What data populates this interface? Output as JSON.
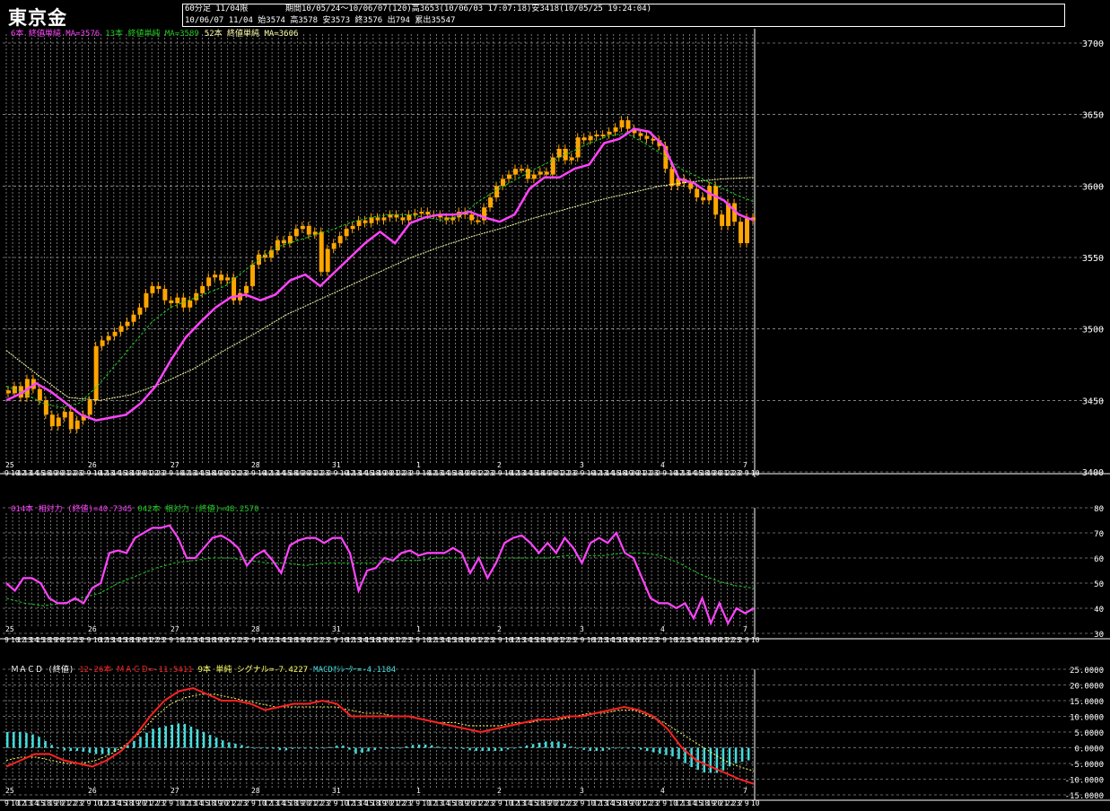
{
  "header": {
    "instrument": "東京金",
    "timeframe": "60分足 11/04限",
    "period": "期間10/05/24～10/06/07(120)高3653(10/06/03 17:07:18)安3418(10/05/25 19:24:04)",
    "last": "10/06/07 11/04 始3574 高3578 安3573 終3576 出794 累出35547"
  },
  "legends": {
    "price": [
      {
        "text": "6本 終値単純 MA=3576",
        "color": "#ff44ff"
      },
      {
        "text": "13本 終値単純 MA=3589",
        "color": "#22cc22"
      },
      {
        "text": "52本 終値単純 MA=3606",
        "color": "#ffffaa"
      }
    ],
    "rsi": [
      {
        "text": "014本 相対力 (終値)=40.7345",
        "color": "#ff44ff"
      },
      {
        "text": "042本 相対力 (終値)=48.2570",
        "color": "#22cc22"
      }
    ],
    "macd": [
      {
        "text": "ＭＡＣＤ (終値)",
        "color": "#ffffff"
      },
      {
        "text": "12-26本 ＭＡＣＤ=-11.5411",
        "color": "#ff2222"
      },
      {
        "text": "9本 単純 シグナル=-7.4227",
        "color": "#ffff66"
      },
      {
        "text": "MACDｵｼﾚｰﾀｰ=-4.1184",
        "color": "#44dddd"
      }
    ]
  },
  "colors": {
    "candle": "#ffa500",
    "ma6": "#ff44ff",
    "ma13": "#22cc22",
    "ma52": "#ffffaa",
    "rsi14": "#ff44ff",
    "rsi42": "#22cc22",
    "macd": "#ff2222",
    "signal": "#ffff66",
    "hist": "#44dddd"
  },
  "axes": {
    "price_ticks": [
      "3700",
      "3650",
      "3600",
      "3550",
      "3500",
      "3450",
      "3400"
    ],
    "rsi_ticks": [
      "80",
      "70",
      "60",
      "50",
      "40",
      "30"
    ],
    "macd_ticks": [
      "25.0000",
      "20.0000",
      "15.0000",
      "10.0000",
      "5.0000",
      "0.0000",
      "-5.0000",
      "-10.0000",
      "-15.0000"
    ],
    "day_labels": [
      "25",
      "26",
      "27",
      "28",
      "31",
      "1",
      "2",
      "3",
      "4",
      "7"
    ],
    "hour_pattern": [
      "9",
      "10",
      "12",
      "13",
      "14",
      "15",
      "18",
      "19",
      "20",
      "21",
      "22",
      "23",
      "2"
    ]
  },
  "chart_data": [
    {
      "type": "candlestick",
      "title": "東京金 60分足 11/04限",
      "ylim": [
        3400,
        3700
      ],
      "x_days": [
        "25",
        "26",
        "27",
        "28",
        "31",
        "1",
        "2",
        "3",
        "4",
        "7"
      ],
      "close_approx": [
        3455,
        3460,
        3452,
        3465,
        3458,
        3450,
        3440,
        3432,
        3438,
        3442,
        3430,
        3436,
        3440,
        3450,
        3488,
        3492,
        3495,
        3498,
        3502,
        3505,
        3510,
        3515,
        3525,
        3530,
        3528,
        3520,
        3518,
        3522,
        3515,
        3520,
        3525,
        3530,
        3536,
        3538,
        3534,
        3536,
        3520,
        3525,
        3530,
        3545,
        3552,
        3550,
        3555,
        3562,
        3560,
        3565,
        3570,
        3572,
        3566,
        3568,
        3540,
        3556,
        3560,
        3565,
        3570,
        3572,
        3576,
        3574,
        3578,
        3576,
        3578,
        3580,
        3578,
        3576,
        3580,
        3581,
        3582,
        3580,
        3580,
        3578,
        3576,
        3578,
        3582,
        3580,
        3576,
        3576,
        3585,
        3592,
        3600,
        3605,
        3608,
        3612,
        3612,
        3605,
        3608,
        3610,
        3608,
        3620,
        3626,
        3618,
        3620,
        3634,
        3632,
        3635,
        3636,
        3636,
        3638,
        3641,
        3646,
        3640,
        3637,
        3635,
        3633,
        3632,
        3628,
        3612,
        3600,
        3605,
        3602,
        3598,
        3592,
        3590,
        3600,
        3580,
        3572,
        3588,
        3575,
        3560,
        3578,
        3576
      ],
      "ma6_approx": [
        3450,
        3455,
        3462,
        3456,
        3448,
        3440,
        3436,
        3438,
        3440,
        3448,
        3460,
        3478,
        3494,
        3505,
        3515,
        3522,
        3524,
        3520,
        3524,
        3534,
        3538,
        3530,
        3540,
        3550,
        3560,
        3568,
        3560,
        3574,
        3578,
        3580,
        3580,
        3582,
        3578,
        3575,
        3580,
        3598,
        3606,
        3606,
        3612,
        3615,
        3630,
        3633,
        3640,
        3638,
        3628,
        3605,
        3602,
        3595,
        3590,
        3580,
        3576
      ],
      "ma13_approx": [
        3460,
        3455,
        3448,
        3445,
        3448,
        3460,
        3475,
        3490,
        3505,
        3515,
        3520,
        3525,
        3530,
        3540,
        3550,
        3558,
        3562,
        3566,
        3570,
        3575,
        3578,
        3580,
        3580,
        3578,
        3576,
        3580,
        3590,
        3598,
        3605,
        3612,
        3618,
        3624,
        3630,
        3635,
        3637,
        3630,
        3622,
        3612,
        3606,
        3600,
        3594,
        3589
      ],
      "ma52_approx": [
        3485,
        3468,
        3452,
        3450,
        3454,
        3462,
        3472,
        3485,
        3497,
        3510,
        3520,
        3530,
        3540,
        3550,
        3558,
        3565,
        3571,
        3578,
        3584,
        3590,
        3595,
        3600,
        3603,
        3605,
        3606
      ]
    },
    {
      "type": "line",
      "title": "014本 相対力 (終値)",
      "ylim": [
        30,
        80
      ],
      "series": [
        {
          "name": "014本 相対力 (終値)",
          "values": [
            50,
            47,
            52,
            52,
            50,
            44,
            42,
            42,
            44,
            42,
            48,
            50,
            62,
            63,
            62,
            68,
            70,
            72,
            72,
            73,
            68,
            60,
            60,
            64,
            68,
            69,
            67,
            64,
            57,
            61,
            63,
            59,
            54,
            65,
            67,
            68,
            68,
            66,
            68,
            68,
            62,
            47,
            55,
            56,
            60,
            59,
            62,
            63,
            61,
            62,
            62,
            62,
            64,
            62,
            54,
            60,
            52,
            58,
            66,
            68,
            69,
            66,
            62,
            66,
            62,
            68,
            64,
            58,
            66,
            68,
            66,
            70,
            62,
            60,
            52,
            44,
            42,
            42,
            40,
            42,
            36,
            44,
            34,
            42,
            34,
            40,
            38,
            40
          ]
        },
        {
          "name": "042本 相対力 (終値)",
          "values": [
            44,
            42,
            41,
            42,
            44,
            46,
            50,
            53,
            56,
            58,
            59,
            60,
            60,
            59,
            58,
            58,
            57,
            58,
            58,
            58,
            58,
            59,
            59,
            60,
            60,
            60,
            60,
            60,
            60,
            60,
            61,
            61,
            61,
            62,
            62,
            61,
            58,
            54,
            51,
            49,
            48
          ]
        }
      ]
    },
    {
      "type": "line",
      "title": "ＭＡＣＤ (終値)",
      "ylim": [
        -15,
        25
      ],
      "series": [
        {
          "name": "12-26本 ＭＡＣＤ",
          "values": [
            -6,
            -4,
            -2,
            -2,
            -4,
            -5,
            -6,
            -4,
            -1,
            4,
            10,
            15,
            18,
            19,
            17,
            15,
            15,
            14,
            12,
            13,
            14,
            14,
            15,
            14,
            10,
            10,
            10,
            10,
            10,
            9,
            8,
            7,
            6,
            5,
            6,
            7,
            8,
            9,
            9,
            10,
            10,
            11,
            12,
            13,
            12,
            10,
            6,
            0,
            -4,
            -6,
            -8,
            -10,
            -11.5
          ]
        },
        {
          "name": "9本 単純 シグナル",
          "values": [
            -4,
            -3,
            -3,
            -4,
            -5,
            -5,
            -4,
            -2,
            1,
            5,
            10,
            14,
            16,
            17,
            17,
            16,
            15,
            14,
            13,
            13,
            13,
            13,
            13,
            12,
            11,
            11,
            10,
            10,
            9,
            8,
            8,
            7,
            7,
            7,
            8,
            8,
            9,
            9,
            10,
            11,
            11,
            12,
            12,
            10,
            8,
            5,
            2,
            -1,
            -4,
            -6,
            -7.4
          ]
        },
        {
          "name": "MACDｵｼﾚｰﾀｰ",
          "values": [
            5,
            5,
            4,
            1,
            -1,
            -1,
            -2,
            -2,
            0,
            3,
            6,
            7,
            8,
            6,
            4,
            2,
            1,
            0,
            0,
            -1,
            0,
            0,
            0,
            1,
            -2,
            -1,
            0,
            0,
            1,
            1,
            0,
            0,
            -1,
            -1,
            -1,
            0,
            1,
            2,
            2,
            0,
            -1,
            -1,
            0,
            0,
            -1,
            -2,
            -3,
            -6,
            -8,
            -8,
            -5,
            -4
          ]
        }
      ]
    }
  ]
}
